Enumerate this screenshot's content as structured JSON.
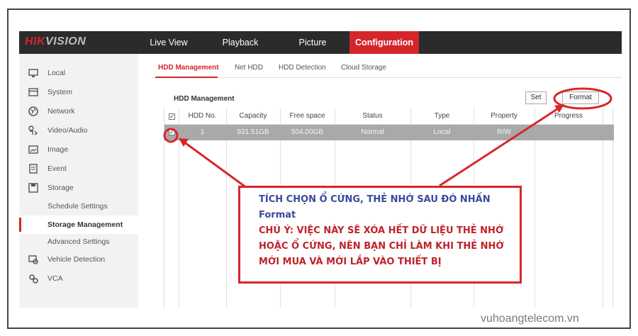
{
  "logo": {
    "part1": "HIK",
    "part2": "VISION"
  },
  "nav": [
    {
      "label": "Live View"
    },
    {
      "label": "Playback"
    },
    {
      "label": "Picture"
    },
    {
      "label": "Configuration",
      "active": true
    }
  ],
  "sidebar": {
    "items": [
      {
        "label": "Local",
        "icon": "monitor-icon"
      },
      {
        "label": "System",
        "icon": "system-icon"
      },
      {
        "label": "Network",
        "icon": "globe-icon"
      },
      {
        "label": "Video/Audio",
        "icon": "video-audio-icon"
      },
      {
        "label": "Image",
        "icon": "image-icon"
      },
      {
        "label": "Event",
        "icon": "event-icon"
      },
      {
        "label": "Storage",
        "icon": "storage-icon"
      },
      {
        "label": "Schedule Settings"
      },
      {
        "label": "Storage Management",
        "selected": true
      },
      {
        "label": "Advanced Settings"
      },
      {
        "label": "Vehicle Detection",
        "icon": "vehicle-detection-icon"
      },
      {
        "label": "VCA",
        "icon": "vca-icon"
      }
    ]
  },
  "tabs": [
    {
      "label": "HDD Management",
      "active": true
    },
    {
      "label": "Net HDD"
    },
    {
      "label": "HDD Detection"
    },
    {
      "label": "Cloud Storage"
    }
  ],
  "panel": {
    "title": "HDD Management",
    "set_label": "Set",
    "format_label": "Format"
  },
  "table": {
    "headers": [
      "HDD No.",
      "Capacity",
      "Free space",
      "Status",
      "Type",
      "Property",
      "Progress"
    ],
    "rows": [
      {
        "checked": true,
        "hdd_no": "1",
        "capacity": "931.51GB",
        "free_space": "504.00GB",
        "status": "Normal",
        "type": "Local",
        "property": "R/W",
        "progress": ""
      }
    ]
  },
  "annotation": {
    "line1": "TÍCH CHỌN Ổ CỨNG, THẺ NHỚ SAU ĐÓ NHẤN",
    "line2": "Format",
    "line3": "CHÚ Ý: VIỆC NÀY SẼ XÓA HẾT DỮ LIỆU THẺ NHỚ",
    "line4": "HOẶC Ổ CỨNG, NÊN BẠN CHỈ LÀM KHI THẺ NHỚ",
    "line5": "MỚI MUA VÀ MỚI LẮP VÀO THIẾT BỊ",
    "color_blue": "#3a4a9c",
    "color_red": "#c0232a"
  },
  "watermark": "vuhoangtelecom.vn",
  "colors": {
    "accent": "#d4252b",
    "topbar": "#2b2b2b",
    "selected_row": "#a9a9a9"
  }
}
